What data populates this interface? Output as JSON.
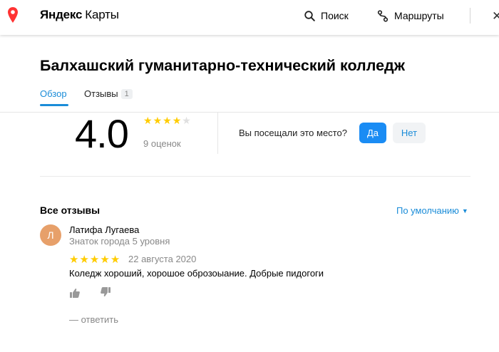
{
  "header": {
    "logo_brand": "Яндекс",
    "logo_product": "Карты",
    "search_label": "Поиск",
    "routes_label": "Маршруты",
    "close_glyph": "✕"
  },
  "org": {
    "title": "Балхашский гуманитарно-технический колледж"
  },
  "tabs": [
    {
      "label": "Обзор",
      "active": true
    },
    {
      "label": "Отзывы",
      "count": "1"
    }
  ],
  "rating": {
    "value": "4.0",
    "stars": 4,
    "max_stars": 5,
    "votes": "9 оценок"
  },
  "visit": {
    "question": "Вы посещали это место?",
    "yes_label": "Да",
    "no_label": "Нет"
  },
  "reviews_section": {
    "title": "Все отзывы",
    "sort_label": "По умолчанию",
    "items": [
      {
        "avatar_letter": "Л",
        "author": "Латифа Лугаева",
        "level": "Знаток города 5 уровня",
        "stars": 5,
        "date": "22 августа 2020",
        "text": "Коледж хороший, хорошое оброзоыание. Добрые пидогоги",
        "reply_label": "— ответить"
      }
    ]
  },
  "colors": {
    "accent": "#1a8cd8",
    "primary_button": "#1a8cf4",
    "star": "#ffcc00",
    "pin": "#f33",
    "avatar": "#e7a06a"
  }
}
